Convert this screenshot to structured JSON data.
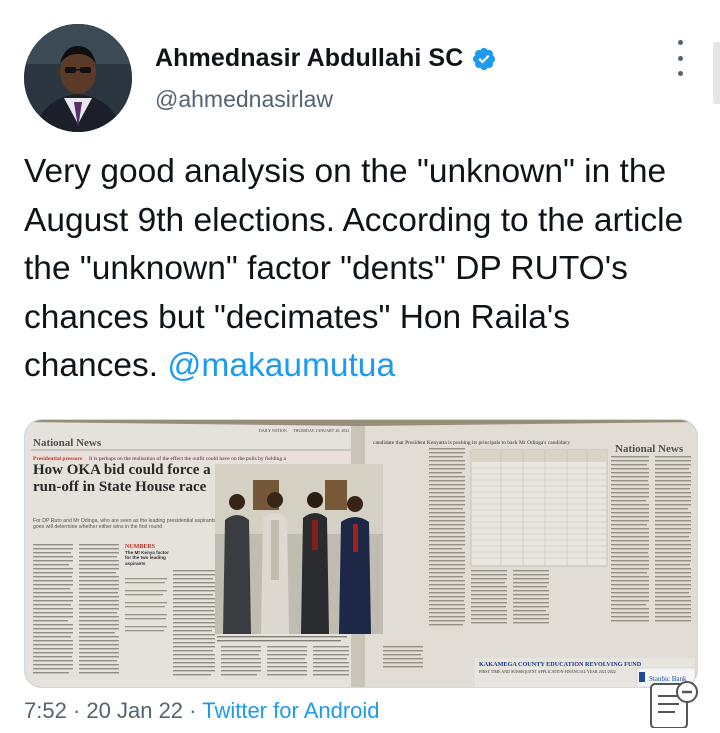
{
  "author": {
    "name": "Ahmednasir Abdullahi SC",
    "handle": "@ahmednasirlaw",
    "verified": true,
    "avatar_icon": "profile-photo"
  },
  "tweet": {
    "text": "Very good analysis on the \"unknown\" in the August 9th elections. According to the article the \"unknown\" factor \"dents\" DP RUTO's chances but \"decimates\" Hon Raila's chances.",
    "mention": "@makaumutua"
  },
  "media": {
    "left_section": "National News",
    "right_section": "National News",
    "kicker": "Presidential pressure",
    "kicker_text": "It is perhaps on the realisation of the effect the outfit could have on the polls by fielding a",
    "right_headline": "candidate that President Kenyatta is pushing its principals to back Mr Odinga's candidacy",
    "headline": "How OKA bid could force a run-off in State House race",
    "standfirst": "For DP Ruto and Mr Odinga, who are seen as the leading presidential aspirants, a few other factors such as how the OKA vote goes will determine whether either wins in the first round",
    "numbers_box": "NUMBERS",
    "numbers_sub": "The Mt Kenya factor for the two leading aspirants",
    "bottom_banner_1": "KAKAMEGA COUNTY EDUCATION REVOLVING FUND",
    "bottom_banner_2": "FIRST TIME AND SUBSEQUENT APPLICATION FINANCIAL YEAR 2021/2022",
    "bank_ad": "Stanbic Bank",
    "newspaper_name": "DAILY NATION",
    "dateline": "THURSDAY, JANUARY 20, 2022"
  },
  "footer": {
    "time": "7:52",
    "sep1": "·",
    "date": "20 Jan 22",
    "sep2": "·",
    "source": "Twitter for Android"
  },
  "colors": {
    "text": "#0f1419",
    "muted": "#536471",
    "accent": "#1d9bf0"
  }
}
